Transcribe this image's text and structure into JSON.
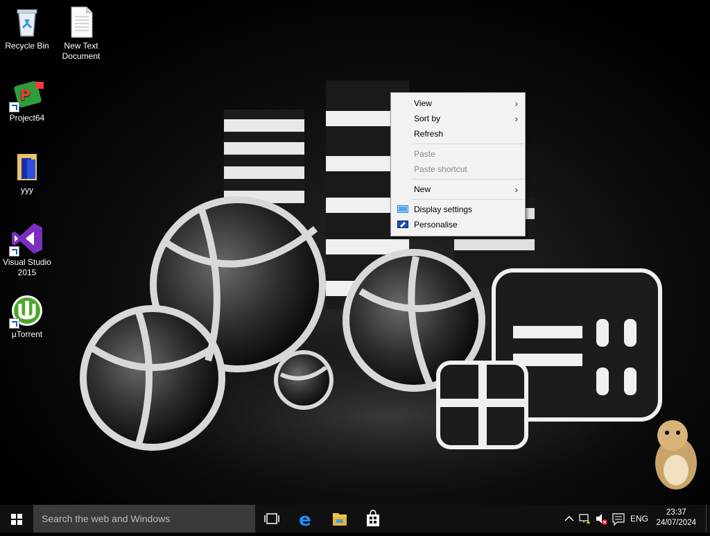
{
  "desktop": {
    "icons": [
      {
        "label": "Recycle Bin",
        "icon": "recycle-bin-icon"
      },
      {
        "label": "New Text\nDocument",
        "icon": "text-document-icon"
      },
      {
        "label": "Project64",
        "icon": "project64-icon"
      },
      {
        "label": "yyy",
        "icon": "folder-icon"
      },
      {
        "label": "Visual Studio\n2015",
        "icon": "visual-studio-icon"
      },
      {
        "label": "µTorrent",
        "icon": "utorrent-icon"
      }
    ]
  },
  "context_menu": {
    "items": [
      {
        "label": "View",
        "submenu": true,
        "enabled": true
      },
      {
        "label": "Sort by",
        "submenu": true,
        "enabled": true
      },
      {
        "label": "Refresh",
        "submenu": false,
        "enabled": true
      },
      {
        "label": "Paste",
        "submenu": false,
        "enabled": false
      },
      {
        "label": "Paste shortcut",
        "submenu": false,
        "enabled": false
      },
      {
        "label": "New",
        "submenu": true,
        "enabled": true
      },
      {
        "label": "Display settings",
        "submenu": false,
        "enabled": true,
        "icon": "display-settings-icon"
      },
      {
        "label": "Personalise",
        "submenu": false,
        "enabled": true,
        "icon": "personalise-icon"
      }
    ]
  },
  "taskbar": {
    "search_placeholder": "Search the web and Windows",
    "pinned": [
      "task-view-icon",
      "edge-icon",
      "file-explorer-icon",
      "store-icon"
    ],
    "tray": {
      "language": "ENG",
      "time": "23:37",
      "date": "24/07/2024"
    }
  },
  "colors": {
    "taskbar": "#101010",
    "search_box": "#3a3a3a",
    "menu_bg": "#f2f2f2",
    "accent_blue": "#1a73e8"
  }
}
